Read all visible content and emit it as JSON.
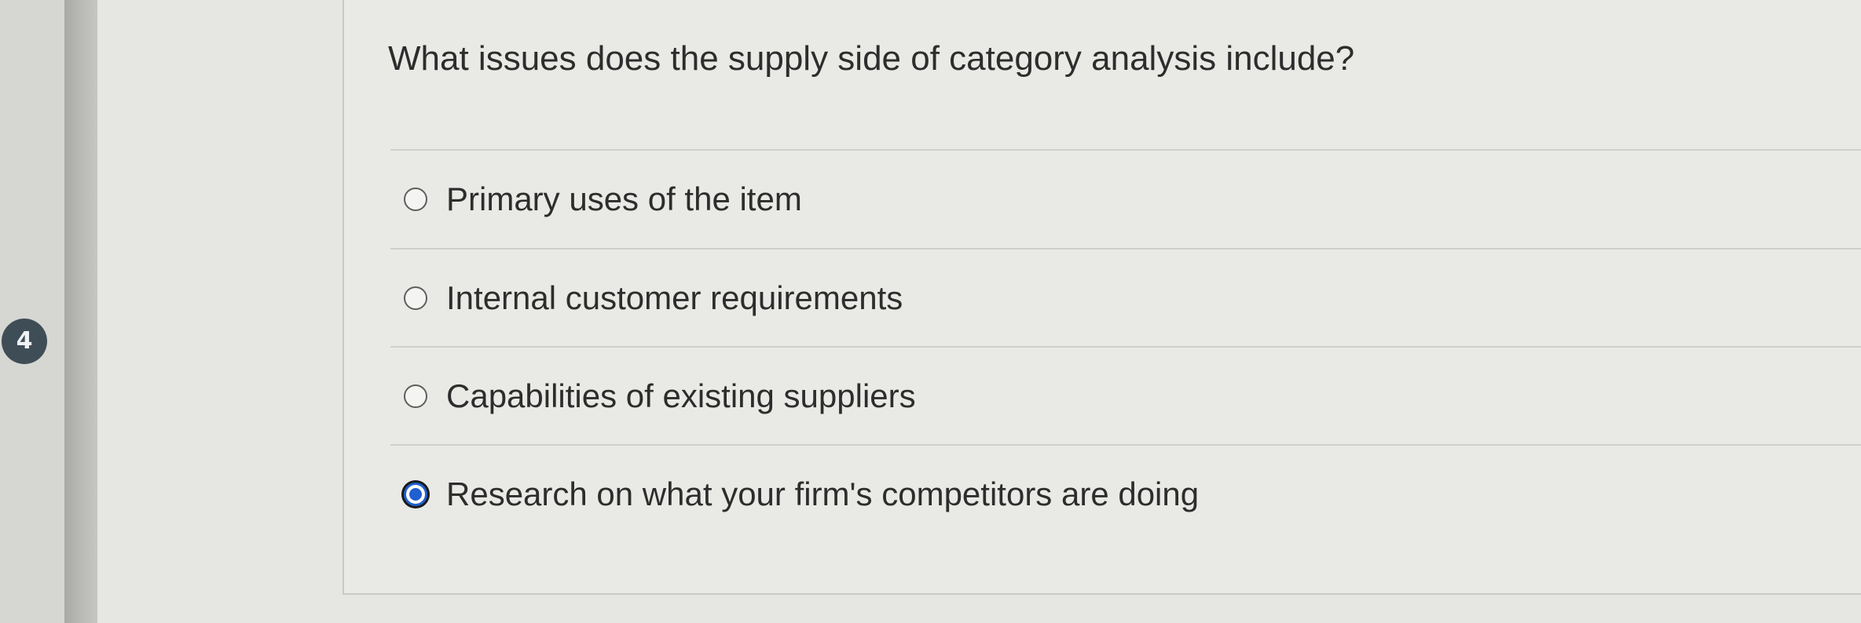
{
  "question": {
    "number": "4",
    "prompt": "What issues does the supply side of category analysis include?",
    "options": [
      {
        "label": "Primary uses of the item",
        "selected": false
      },
      {
        "label": "Internal customer requirements",
        "selected": false
      },
      {
        "label": "Capabilities of existing suppliers",
        "selected": false
      },
      {
        "label": "Research on what your firm's competitors are doing",
        "selected": true
      }
    ]
  },
  "colors": {
    "selected_radio": "#1f5fcf",
    "question_badge": "#3f4d57"
  }
}
